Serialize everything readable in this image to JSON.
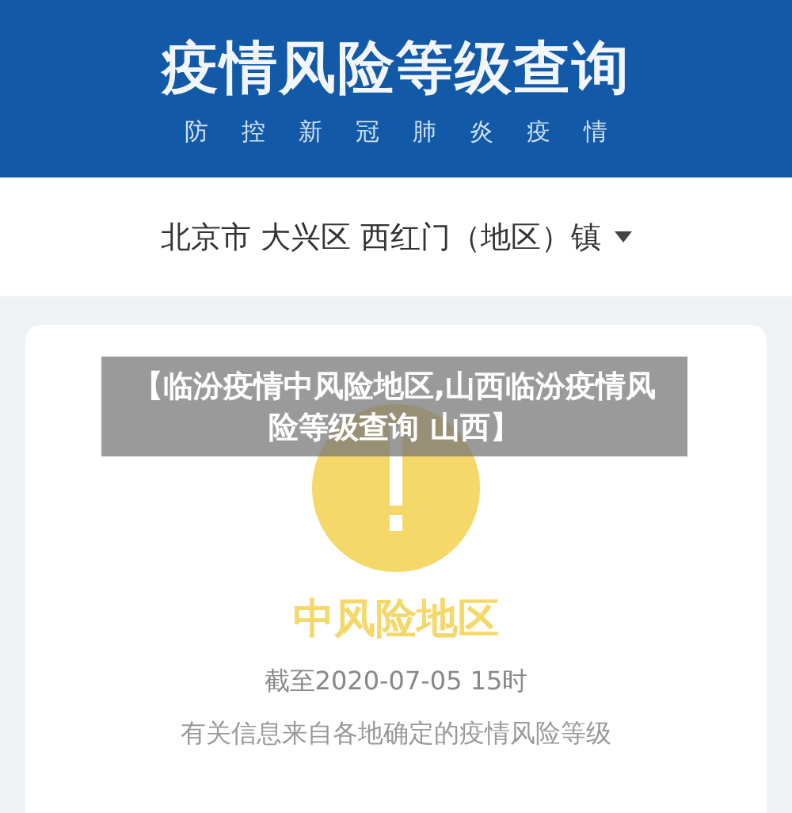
{
  "header": {
    "title": "疫情风险等级查询",
    "subtitle": [
      "防",
      "控",
      "新",
      "冠",
      "肺",
      "炎",
      "疫",
      "情"
    ]
  },
  "location": {
    "value": "北京市 大兴区 西红门（地区）镇"
  },
  "result": {
    "kind": "medium",
    "level_label": "中风险地区",
    "as_of": "截至2020-07-05 15时",
    "note": "有关信息来自各地确定的疫情风险等级"
  },
  "caption_overlay": "【临汾疫情中风险地区,山西临汾疫情风险等级查询 山西】"
}
